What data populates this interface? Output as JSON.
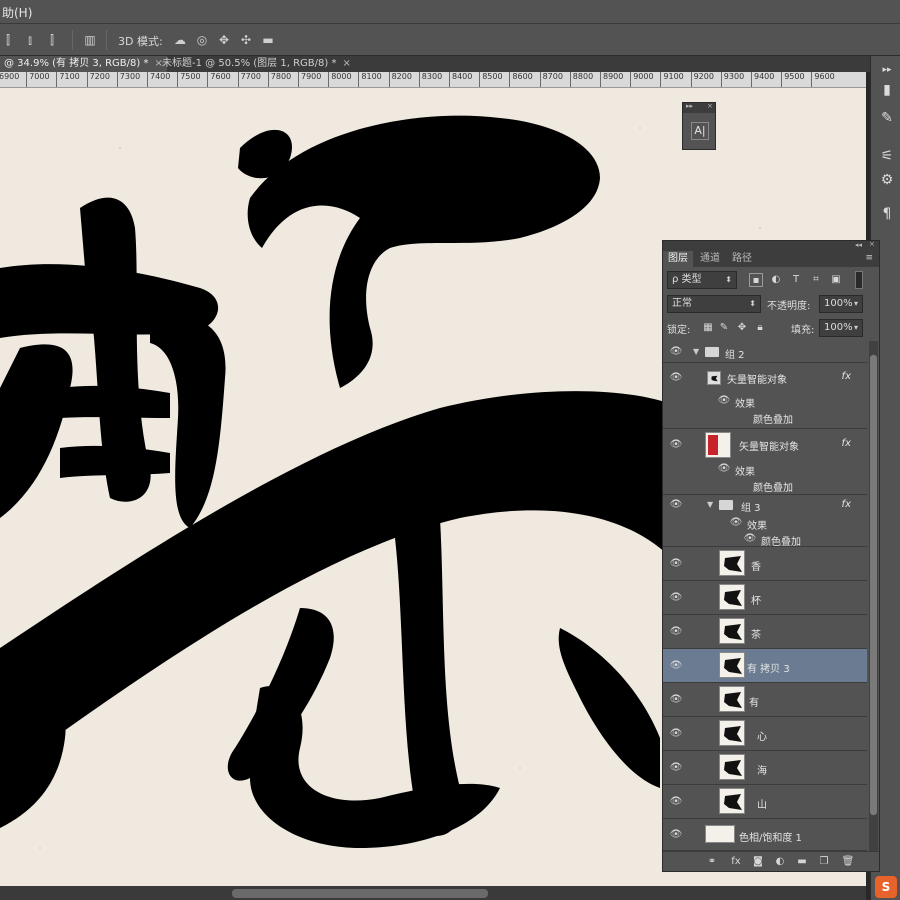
{
  "menubar": {
    "text": "助(H)"
  },
  "options": {
    "mode_label": "3D 模式:"
  },
  "doc_tabs": [
    {
      "label": "@ 34.9% (有 拷贝 3, RGB/8) *",
      "close": "×",
      "active": true
    },
    {
      "label": "未标题-1 @ 50.5% (图层 1, RGB/8) *",
      "close": "×",
      "active": false
    }
  ],
  "ruler": [
    "6900",
    "7000",
    "7100",
    "7200",
    "7300",
    "7400",
    "7500",
    "7600",
    "7700",
    "7800",
    "7900",
    "8000",
    "8100",
    "8200",
    "8300",
    "8400",
    "8500",
    "8600",
    "8700",
    "8800",
    "8900",
    "9000",
    "9100",
    "9200",
    "9300",
    "9400",
    "9500",
    "9600"
  ],
  "char_panel": {
    "icon_text": "A|",
    "collapse": "▸▸",
    "close": "×"
  },
  "layers_panel": {
    "collapse": "◂◂",
    "close": "×",
    "tabs": [
      "图层",
      "通道",
      "路径"
    ],
    "menu_icon": "≡",
    "filter": "ρ 类型",
    "blend_mode": "正常",
    "opacity_label": "不透明度:",
    "opacity_value": "100%",
    "lock_label": "锁定:",
    "fill_label": "填充:",
    "fill_value": "100%",
    "layers": [
      {
        "name": "组 2",
        "kind": "group",
        "indent": 0
      },
      {
        "name": "矢量智能对象",
        "kind": "vector",
        "fx": "fx",
        "indent": 1
      },
      {
        "name": "效果",
        "kind": "effect",
        "indent": 2
      },
      {
        "name": "颜色叠加",
        "kind": "effect-item",
        "indent": 2
      },
      {
        "name": "矢量智能对象",
        "kind": "seal",
        "fx": "fx",
        "indent": 1
      },
      {
        "name": "效果",
        "kind": "effect",
        "indent": 2
      },
      {
        "name": "颜色叠加",
        "kind": "effect-item",
        "indent": 2
      },
      {
        "name": "组 3",
        "kind": "group",
        "fx": "fx",
        "indent": 1
      },
      {
        "name": "效果",
        "kind": "effect",
        "indent": 2
      },
      {
        "name": "颜色叠加",
        "kind": "effect-item",
        "indent": 2
      },
      {
        "name": "香",
        "kind": "pixel",
        "indent": 2
      },
      {
        "name": "杯",
        "kind": "pixel",
        "indent": 2
      },
      {
        "name": "茶",
        "kind": "pixel",
        "indent": 2
      },
      {
        "name": "有 拷贝 3",
        "kind": "pixel",
        "indent": 2,
        "selected": true
      },
      {
        "name": "有",
        "kind": "pixel",
        "indent": 2
      },
      {
        "name": "心",
        "kind": "pixel",
        "indent": 2
      },
      {
        "name": "海",
        "kind": "pixel",
        "indent": 2
      },
      {
        "name": "山",
        "kind": "pixel",
        "indent": 2
      },
      {
        "name": "色相/饱和度 1",
        "kind": "adjustment",
        "indent": 0
      }
    ]
  },
  "icons": {
    "eye": "eye-icon",
    "folder": "folder-icon",
    "link": "link-icon",
    "new_layer": "new-layer-icon",
    "trash": "trash-icon"
  },
  "colors": {
    "panel": "#535353",
    "selected_row": "#6b7b91",
    "canvas_paper": "#efe9df",
    "ink": "#000000",
    "seal_red": "#c8222a",
    "badge": "#e8622b"
  }
}
